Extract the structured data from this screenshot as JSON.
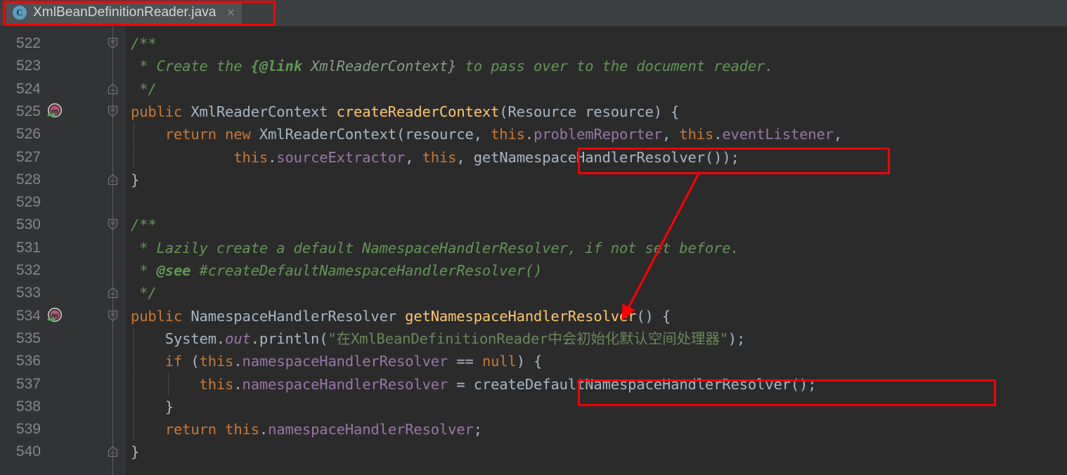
{
  "window": {
    "theme": "darcula",
    "editor_background": "#2b2b2b",
    "gutter_background": "#313335",
    "annotation_color": "#ff0000"
  },
  "tabbar": {
    "tab": {
      "icon": "java-class-icon",
      "icon_letter": "C",
      "title": "XmlBeanDefinitionReader.java",
      "close_label": "×"
    }
  },
  "editor": {
    "first_line": 522,
    "last_line": 540,
    "lines": [
      {
        "number": "522",
        "fold": "start",
        "marker": null,
        "indent_guides": []
      },
      {
        "number": "523",
        "fold": null,
        "marker": null,
        "indent_guides": []
      },
      {
        "number": "524",
        "fold": "end",
        "marker": null,
        "indent_guides": []
      },
      {
        "number": "525",
        "fold": "start",
        "marker": "method-override-icon",
        "indent_guides": []
      },
      {
        "number": "526",
        "fold": null,
        "marker": null,
        "indent_guides": [
          0
        ]
      },
      {
        "number": "527",
        "fold": null,
        "marker": null,
        "indent_guides": [
          0
        ]
      },
      {
        "number": "528",
        "fold": "end",
        "marker": null,
        "indent_guides": []
      },
      {
        "number": "529",
        "fold": null,
        "marker": null,
        "indent_guides": []
      },
      {
        "number": "530",
        "fold": "start",
        "marker": null,
        "indent_guides": []
      },
      {
        "number": "531",
        "fold": null,
        "marker": null,
        "indent_guides": []
      },
      {
        "number": "532",
        "fold": null,
        "marker": null,
        "indent_guides": []
      },
      {
        "number": "533",
        "fold": "end",
        "marker": null,
        "indent_guides": []
      },
      {
        "number": "534",
        "fold": "start",
        "marker": "method-override-icon",
        "indent_guides": []
      },
      {
        "number": "535",
        "fold": null,
        "marker": null,
        "indent_guides": [
          0
        ]
      },
      {
        "number": "536",
        "fold": null,
        "marker": null,
        "indent_guides": [
          0
        ]
      },
      {
        "number": "537",
        "fold": null,
        "marker": null,
        "indent_guides": [
          0,
          1
        ]
      },
      {
        "number": "538",
        "fold": null,
        "marker": null,
        "indent_guides": [
          0
        ]
      },
      {
        "number": "539",
        "fold": null,
        "marker": null,
        "indent_guides": [
          0
        ]
      },
      {
        "number": "540",
        "fold": "end",
        "marker": null,
        "indent_guides": []
      }
    ],
    "source_text": [
      "    /**",
      "     * Create the {@link XmlReaderContext} to pass over to the document reader.",
      "     */",
      "    public XmlReaderContext createReaderContext(Resource resource) {",
      "        return new XmlReaderContext(resource, this.problemReporter, this.eventListener,",
      "                this.sourceExtractor, this, getNamespaceHandlerResolver());",
      "    }",
      "",
      "    /**",
      "     * Lazily create a default NamespaceHandlerResolver, if not set before.",
      "     * @see #createDefaultNamespaceHandlerResolver()",
      "     */",
      "    public NamespaceHandlerResolver getNamespaceHandlerResolver() {",
      "        System.out.println(\"在XmlBeanDefinitionReader中会初始化默认空间处理器\");",
      "        if (this.namespaceHandlerResolver == null) {",
      "            this.namespaceHandlerResolver = createDefaultNamespaceHandlerResolver();",
      "        }",
      "        return this.namespaceHandlerResolver;",
      "    }"
    ],
    "tokens": {
      "l522": [
        {
          "t": "/**",
          "c": "doc"
        }
      ],
      "l523": [
        {
          "t": " * Create the ",
          "c": "doc"
        },
        {
          "t": "{@link",
          "c": "docb"
        },
        {
          "t": " XmlReaderContext}",
          "c": "doct"
        },
        {
          "t": " to pass over to the document reader.",
          "c": "doc"
        }
      ],
      "l524": [
        {
          "t": " */",
          "c": "doc"
        }
      ],
      "l525": [
        {
          "t": "public",
          "c": "kw"
        },
        {
          "t": " XmlReaderContext ",
          "c": "id"
        },
        {
          "t": "createReaderContext",
          "c": "mth"
        },
        {
          "t": "(Resource resource) {",
          "c": "id"
        }
      ],
      "l526": [
        {
          "t": "    ",
          "c": "id"
        },
        {
          "t": "return",
          "c": "kw"
        },
        {
          "t": " ",
          "c": "id"
        },
        {
          "t": "new",
          "c": "kw"
        },
        {
          "t": " XmlReaderContext(resource, ",
          "c": "id"
        },
        {
          "t": "this",
          "c": "kw"
        },
        {
          "t": ".",
          "c": "id"
        },
        {
          "t": "problemReporter",
          "c": "fld"
        },
        {
          "t": ", ",
          "c": "id"
        },
        {
          "t": "this",
          "c": "kw"
        },
        {
          "t": ".",
          "c": "id"
        },
        {
          "t": "eventListener",
          "c": "fld"
        },
        {
          "t": ",",
          "c": "id"
        }
      ],
      "l527": [
        {
          "t": "            ",
          "c": "id"
        },
        {
          "t": "this",
          "c": "kw"
        },
        {
          "t": ".",
          "c": "id"
        },
        {
          "t": "sourceExtractor",
          "c": "fld"
        },
        {
          "t": ", ",
          "c": "id"
        },
        {
          "t": "this",
          "c": "kw"
        },
        {
          "t": ", getNamespaceHandlerResolver());",
          "c": "id"
        }
      ],
      "l528": [
        {
          "t": "}",
          "c": "id"
        }
      ],
      "l529": [
        {
          "t": "",
          "c": "id"
        }
      ],
      "l530": [
        {
          "t": "/**",
          "c": "doc"
        }
      ],
      "l531": [
        {
          "t": " * Lazily create a default NamespaceHandlerResolver, if not set before.",
          "c": "doc"
        }
      ],
      "l532": [
        {
          "t": " * ",
          "c": "doc"
        },
        {
          "t": "@see",
          "c": "docb"
        },
        {
          "t": " #createDefaultNamespaceHandlerResolver()",
          "c": "doc"
        }
      ],
      "l533": [
        {
          "t": " */",
          "c": "doc"
        }
      ],
      "l534": [
        {
          "t": "public",
          "c": "kw"
        },
        {
          "t": " NamespaceHandlerResolver ",
          "c": "id"
        },
        {
          "t": "getNamespaceHandlerResolver",
          "c": "mth"
        },
        {
          "t": "() {",
          "c": "id"
        }
      ],
      "l535": [
        {
          "t": "    System.",
          "c": "id"
        },
        {
          "t": "out",
          "c": "sfld"
        },
        {
          "t": ".println(",
          "c": "id"
        },
        {
          "t": "\"在XmlBeanDefinitionReader中会初始化默认空间处理器\"",
          "c": "str"
        },
        {
          "t": ");",
          "c": "id"
        }
      ],
      "l536": [
        {
          "t": "    ",
          "c": "id"
        },
        {
          "t": "if",
          "c": "kw"
        },
        {
          "t": " (",
          "c": "id"
        },
        {
          "t": "this",
          "c": "kw"
        },
        {
          "t": ".",
          "c": "id"
        },
        {
          "t": "namespaceHandlerResolver",
          "c": "fld"
        },
        {
          "t": " == ",
          "c": "id"
        },
        {
          "t": "null",
          "c": "kw"
        },
        {
          "t": ") {",
          "c": "id"
        }
      ],
      "l537": [
        {
          "t": "        ",
          "c": "id"
        },
        {
          "t": "this",
          "c": "kw"
        },
        {
          "t": ".",
          "c": "id"
        },
        {
          "t": "namespaceHandlerResolver",
          "c": "fld"
        },
        {
          "t": " = createDefaultNamespaceHandlerResolver()",
          "c": "id"
        },
        {
          "t": ";",
          "c": "id"
        }
      ],
      "l538": [
        {
          "t": "    }",
          "c": "id"
        }
      ],
      "l539": [
        {
          "t": "    ",
          "c": "id"
        },
        {
          "t": "return",
          "c": "kw"
        },
        {
          "t": " ",
          "c": "id"
        },
        {
          "t": "this",
          "c": "kw"
        },
        {
          "t": ".",
          "c": "id"
        },
        {
          "t": "namespaceHandlerResolver",
          "c": "fld"
        },
        {
          "t": ";",
          "c": "id"
        }
      ],
      "l540": [
        {
          "t": "}",
          "c": "id"
        }
      ]
    }
  },
  "annotations": {
    "boxes": [
      {
        "name": "call-site-getNamespaceHandlerResolver",
        "label": "getNamespaceHandlerResolver()"
      },
      {
        "name": "call-site-createDefaultNamespaceHandlerResolver",
        "label": "createDefaultNamespaceHandlerResolver()"
      },
      {
        "name": "tab-highlight",
        "label": "XmlBeanDefinitionReader.java"
      }
    ],
    "arrow": {
      "name": "navigation-arrow",
      "from": "getNamespaceHandlerResolver() call on line 527",
      "to": "getNamespaceHandlerResolver() declaration on line 534"
    }
  }
}
